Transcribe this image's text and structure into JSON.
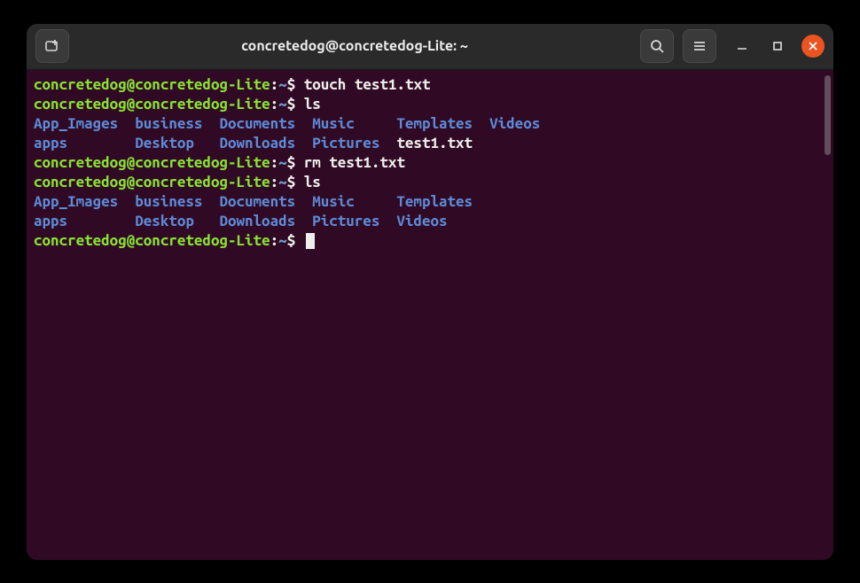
{
  "colors": {
    "bg": "#300a24",
    "titlebar": "#2a2a2a",
    "user": "#8ae234",
    "path": "#729fcf",
    "dir": "#5e8ad6",
    "text": "#eeeeec",
    "close": "#e95420"
  },
  "title": "concretedog@concretedog-Lite: ~",
  "prompt": {
    "user": "concretedog",
    "at": "@",
    "host": "concretedog-Lite",
    "colon": ":",
    "path": "~",
    "dollar": "$"
  },
  "commands": {
    "c1": "touch test1.txt",
    "c2": "ls",
    "c3": "rm test1.txt",
    "c4": "ls",
    "c5": ""
  },
  "ls1": {
    "row1": {
      "a": "App_Images",
      "b": "business",
      "c": "Documents",
      "d": "Music",
      "e": "Templates",
      "f": "Videos"
    },
    "row2": {
      "a": "apps",
      "b": "Desktop",
      "c": "Downloads",
      "d": "Pictures",
      "e": "test1.txt"
    }
  },
  "ls2": {
    "row1": {
      "a": "App_Images",
      "b": "business",
      "c": "Documents",
      "d": "Music",
      "e": "Templates"
    },
    "row2": {
      "a": "apps",
      "b": "Desktop",
      "c": "Downloads",
      "d": "Pictures",
      "e": "Videos"
    }
  },
  "col_widths": {
    "c1": 12,
    "c2": 10,
    "c3": 11,
    "c4": 10,
    "c5": 11
  }
}
